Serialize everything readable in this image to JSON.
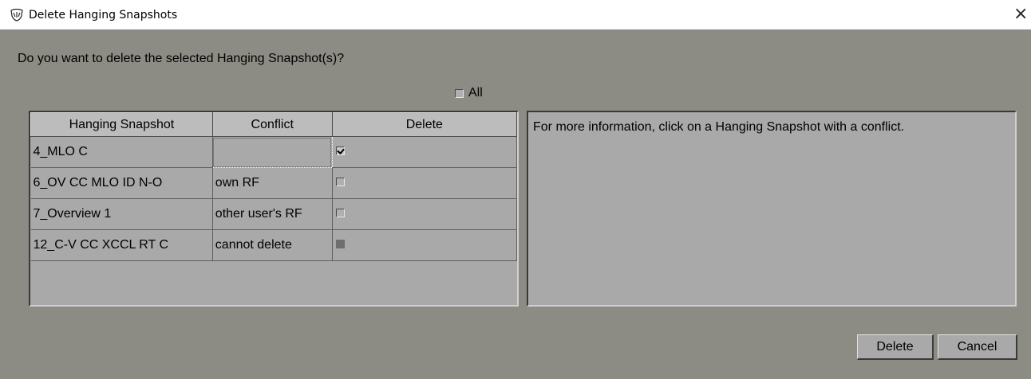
{
  "window": {
    "title": "Delete Hanging Snapshots",
    "icon": "app-shield-icon",
    "close_label": "×"
  },
  "dialog": {
    "question": "Do you want to delete the selected Hanging Snapshot(s)?",
    "all_label": "All",
    "all_checked": false
  },
  "table": {
    "headers": [
      "Hanging Snapshot",
      "Conflict",
      "Delete"
    ],
    "rows": [
      {
        "snapshot": "4_MLO C",
        "conflict": "",
        "delete": "checked"
      },
      {
        "snapshot": "6_OV CC MLO ID N-O",
        "conflict": "own RF",
        "delete": "unchecked"
      },
      {
        "snapshot": "7_Overview 1",
        "conflict": "other user's RF",
        "delete": "unchecked"
      },
      {
        "snapshot": "12_C-V CC XCCL RT C",
        "conflict": "cannot delete",
        "delete": "disabled"
      }
    ]
  },
  "info": {
    "text": "For more information, click on a Hanging Snapshot with a conflict."
  },
  "buttons": {
    "delete_label": "Delete",
    "cancel_label": "Cancel"
  },
  "colors": {
    "background": "#8c8b84",
    "panel": "#a9a9a9",
    "header": "#bcbcbc",
    "titlebar": "#ffffff"
  }
}
